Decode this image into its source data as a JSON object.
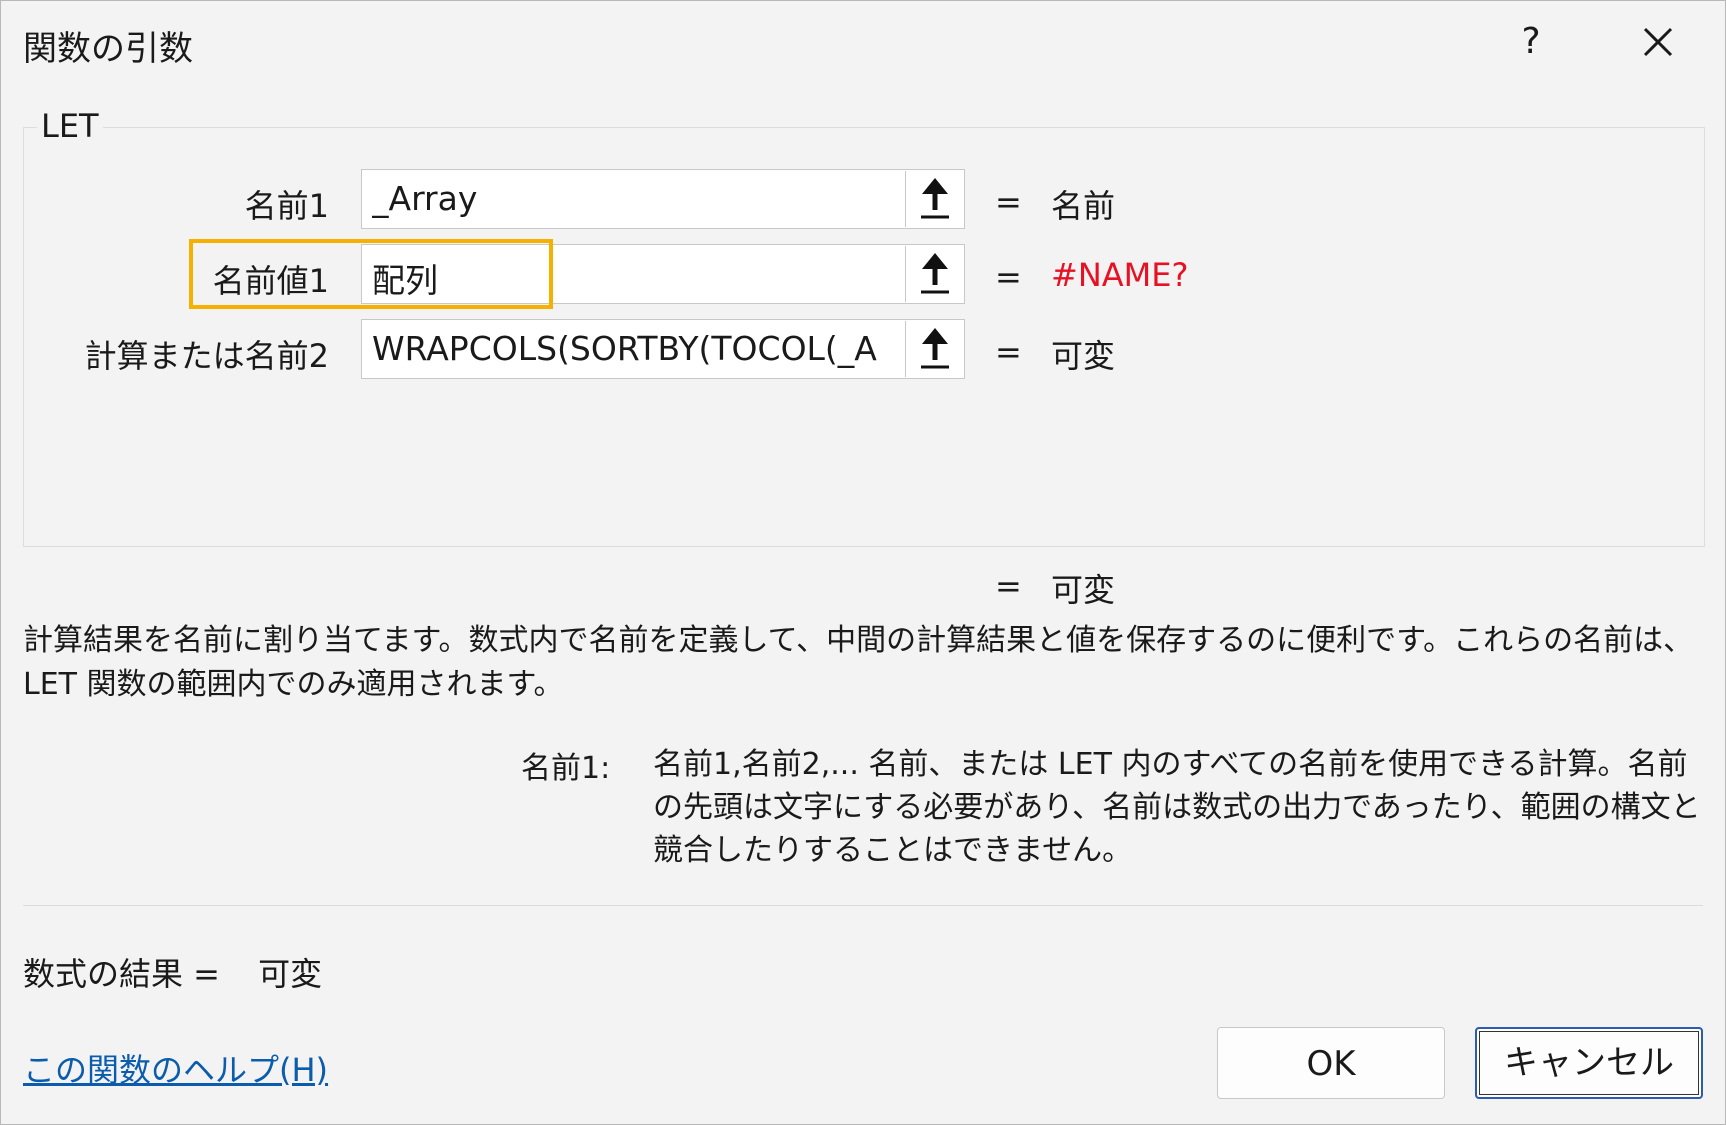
{
  "dialog": {
    "title": "関数の引数",
    "help_glyph": "?",
    "function_name": "LET"
  },
  "args": [
    {
      "label": "名前1",
      "value": "_Array",
      "result": "名前",
      "result_color": "#1a1a1a"
    },
    {
      "label": "名前値1",
      "value": "配列",
      "result": "#NAME?",
      "result_color": "#e81123"
    },
    {
      "label": "計算または名前2",
      "value": "WRAPCOLS(SORTBY(TOCOL(_A",
      "result": "可変",
      "result_color": "#1a1a1a"
    }
  ],
  "eq": "=",
  "overall_result": "可変",
  "description": "計算結果を名前に割り当てます。数式内で名前を定義して、中間の計算結果と値を保存するのに便利です。これらの名前は、LET 関数の範囲内でのみ適用されます。",
  "arg_description": {
    "label": "名前1:",
    "text": "名前1,名前2,... 名前、または LET 内のすべての名前を使用できる計算。名前の先頭は文字にする必要があり、名前は数式の出力であったり、範囲の構文と競合したりすることはできません。"
  },
  "formula_result": {
    "label": "数式の結果 =",
    "value": "可変"
  },
  "help_link": "この関数のヘルプ(H)",
  "buttons": {
    "ok": "OK",
    "cancel": "キャンセル"
  },
  "highlight_color": "#f5b000",
  "icons": {
    "ref_button": "up-arrow-icon",
    "close": "close-icon"
  }
}
